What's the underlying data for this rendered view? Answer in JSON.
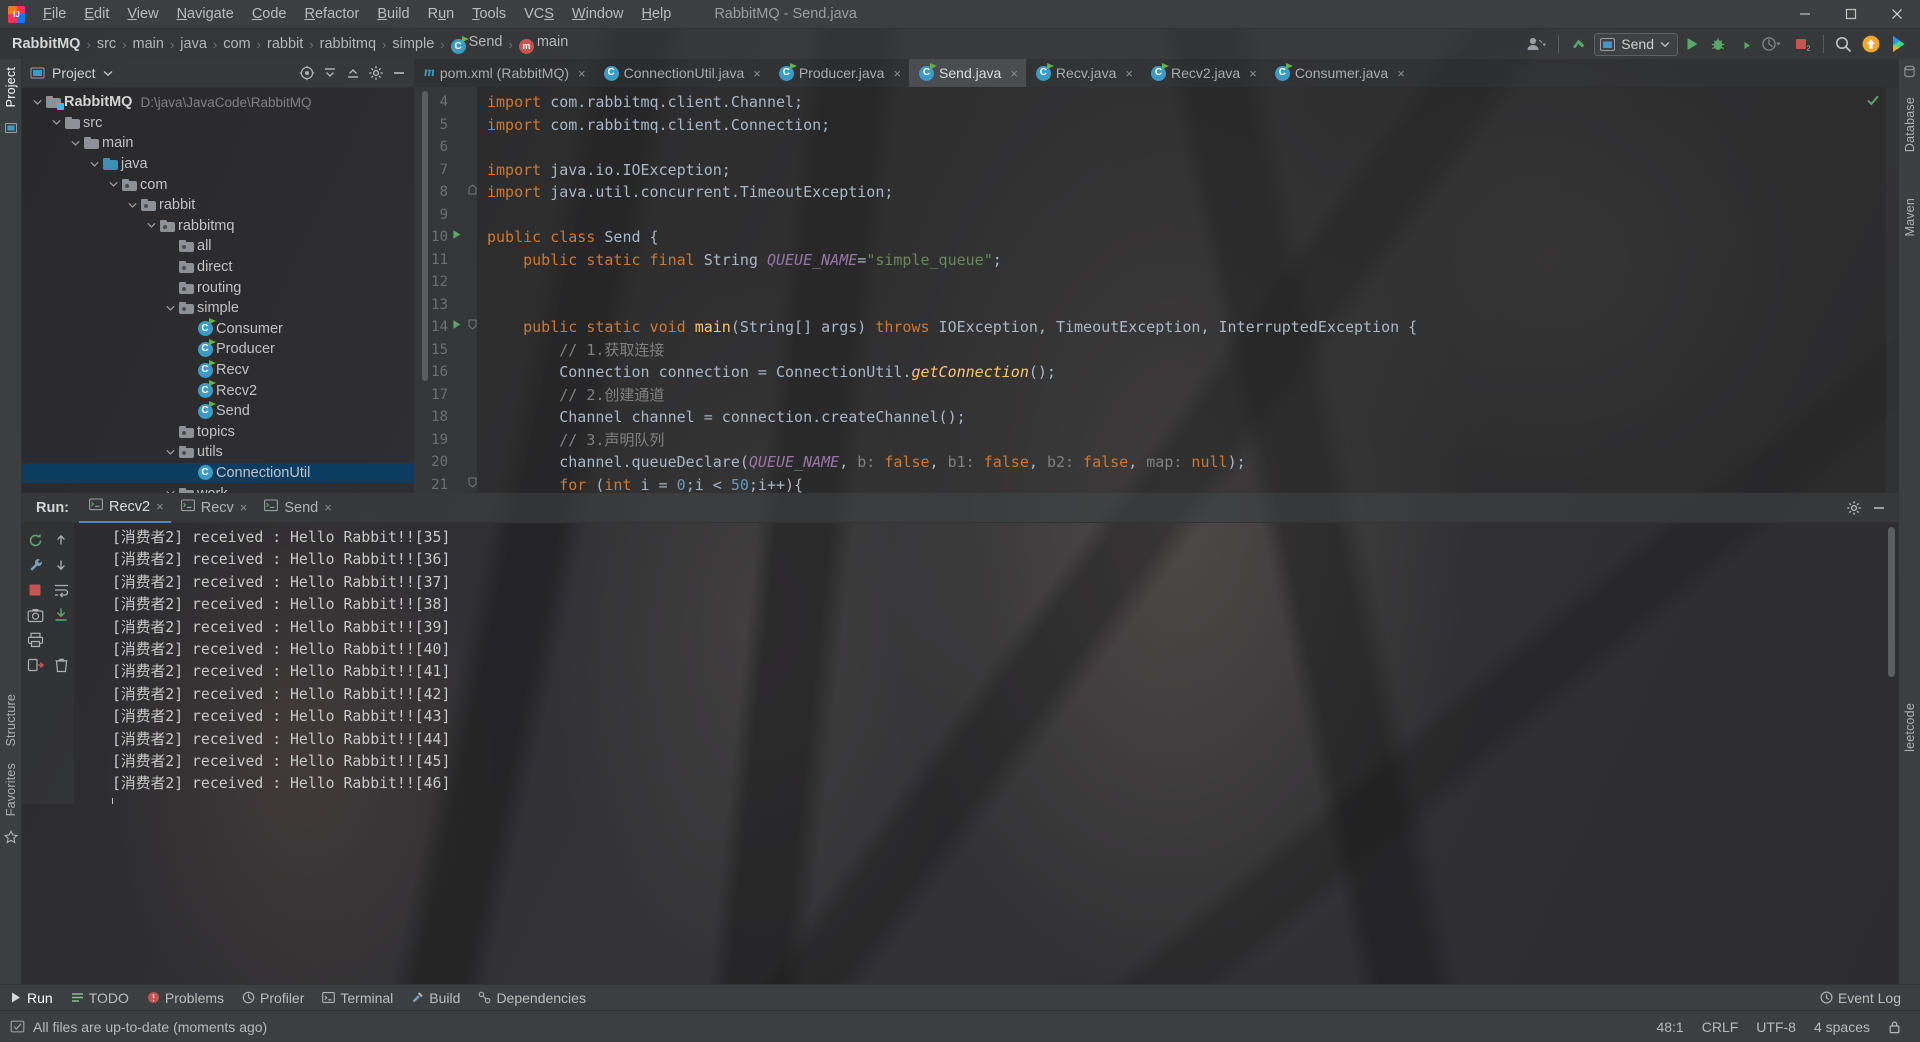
{
  "window": {
    "title": "RabbitMQ - Send.java",
    "menu": [
      "File",
      "Edit",
      "View",
      "Navigate",
      "Code",
      "Refactor",
      "Build",
      "Run",
      "Tools",
      "VCS",
      "Window",
      "Help"
    ],
    "controls": {
      "minimize": "minimize-icon",
      "maximize": "maximize-icon",
      "close": "close-icon"
    }
  },
  "navbar": {
    "breadcrumbs": [
      {
        "label": "RabbitMQ",
        "icon": ""
      },
      {
        "label": "src",
        "icon": ""
      },
      {
        "label": "main",
        "icon": ""
      },
      {
        "label": "java",
        "icon": ""
      },
      {
        "label": "com",
        "icon": ""
      },
      {
        "label": "rabbit",
        "icon": ""
      },
      {
        "label": "rabbitmq",
        "icon": ""
      },
      {
        "label": "simple",
        "icon": ""
      },
      {
        "label": "Send",
        "icon": "class-icon"
      },
      {
        "label": "main",
        "icon": "method-icon"
      }
    ],
    "separator": "›",
    "toolbar": {
      "account": "account-icon",
      "update": "vcs-update-icon",
      "run_config": "Send",
      "run_config_icon": "run-config-icon",
      "dropdown": "chevron-down-icon",
      "run": "run-icon",
      "debug": "debug-icon",
      "coverage": "run-coverage-icon",
      "profiler": "profiler-icon",
      "stop": "stop-icon",
      "stop_badge": "2",
      "search": "search-icon",
      "upload": "upload-icon",
      "idea_feature": "idea-icon"
    }
  },
  "left_strip": {
    "project_label": "Project",
    "structure_label": "Structure",
    "favorites_label": "Favorites",
    "bookmark_icon": "star-icon"
  },
  "right_strip": {
    "labels": [
      "Database",
      "Maven",
      "leetcode"
    ]
  },
  "project_panel": {
    "title": "Project",
    "title_icon": "project-icon",
    "title_dropdown": "chevron-down-icon",
    "actions": [
      "locate-icon",
      "collapse-all-icon",
      "expand-all-icon",
      "settings-icon",
      "hide-icon"
    ],
    "tree": [
      {
        "depth": 0,
        "label": "RabbitMQ",
        "sub": "D:\\java\\JavaCode\\RabbitMQ",
        "icon": "module-icon",
        "arrow": "expanded",
        "bold": true,
        "selected": false
      },
      {
        "depth": 1,
        "label": "src",
        "sub": "",
        "icon": "folder-icon",
        "arrow": "expanded",
        "bold": false,
        "selected": false
      },
      {
        "depth": 2,
        "label": "main",
        "sub": "",
        "icon": "folder-icon",
        "arrow": "expanded",
        "bold": false,
        "selected": false
      },
      {
        "depth": 3,
        "label": "java",
        "sub": "",
        "icon": "source-folder-icon",
        "arrow": "expanded",
        "bold": false,
        "selected": false
      },
      {
        "depth": 4,
        "label": "com",
        "sub": "",
        "icon": "package-icon",
        "arrow": "expanded",
        "bold": false,
        "selected": false
      },
      {
        "depth": 5,
        "label": "rabbit",
        "sub": "",
        "icon": "package-icon",
        "arrow": "expanded",
        "bold": false,
        "selected": false
      },
      {
        "depth": 6,
        "label": "rabbitmq",
        "sub": "",
        "icon": "package-icon",
        "arrow": "expanded",
        "bold": false,
        "selected": false
      },
      {
        "depth": 7,
        "label": "all",
        "sub": "",
        "icon": "package-icon",
        "arrow": "none",
        "bold": false,
        "selected": false
      },
      {
        "depth": 7,
        "label": "direct",
        "sub": "",
        "icon": "package-icon",
        "arrow": "none",
        "bold": false,
        "selected": false
      },
      {
        "depth": 7,
        "label": "routing",
        "sub": "",
        "icon": "package-icon",
        "arrow": "none",
        "bold": false,
        "selected": false
      },
      {
        "depth": 7,
        "label": "simple",
        "sub": "",
        "icon": "package-icon",
        "arrow": "expanded",
        "bold": false,
        "selected": false
      },
      {
        "depth": 8,
        "label": "Consumer",
        "sub": "",
        "icon": "runnable-class-icon",
        "arrow": "none",
        "bold": false,
        "selected": false
      },
      {
        "depth": 8,
        "label": "Producer",
        "sub": "",
        "icon": "runnable-class-icon",
        "arrow": "none",
        "bold": false,
        "selected": false
      },
      {
        "depth": 8,
        "label": "Recv",
        "sub": "",
        "icon": "runnable-class-icon",
        "arrow": "none",
        "bold": false,
        "selected": false
      },
      {
        "depth": 8,
        "label": "Recv2",
        "sub": "",
        "icon": "runnable-class-icon",
        "arrow": "none",
        "bold": false,
        "selected": false
      },
      {
        "depth": 8,
        "label": "Send",
        "sub": "",
        "icon": "runnable-class-icon",
        "arrow": "none",
        "bold": false,
        "selected": false
      },
      {
        "depth": 7,
        "label": "topics",
        "sub": "",
        "icon": "package-icon",
        "arrow": "none",
        "bold": false,
        "selected": false
      },
      {
        "depth": 7,
        "label": "utils",
        "sub": "",
        "icon": "package-icon",
        "arrow": "expanded",
        "bold": false,
        "selected": false
      },
      {
        "depth": 8,
        "label": "ConnectionUtil",
        "sub": "",
        "icon": "class-icon",
        "arrow": "none",
        "bold": false,
        "selected": true
      },
      {
        "depth": 7,
        "label": "work",
        "sub": "",
        "icon": "package-icon",
        "arrow": "expanded",
        "bold": false,
        "selected": false
      }
    ]
  },
  "editor": {
    "tabs": [
      {
        "label": "pom.xml (RabbitMQ)",
        "icon": "maven-icon",
        "active": false
      },
      {
        "label": "ConnectionUtil.java",
        "icon": "class-icon",
        "active": false
      },
      {
        "label": "Producer.java",
        "icon": "runnable-class-icon",
        "active": false
      },
      {
        "label": "Send.java",
        "icon": "runnable-class-icon",
        "active": true
      },
      {
        "label": "Recv.java",
        "icon": "runnable-class-icon",
        "active": false
      },
      {
        "label": "Recv2.java",
        "icon": "runnable-class-icon",
        "active": false
      },
      {
        "label": "Consumer.java",
        "icon": "runnable-class-icon",
        "active": false
      }
    ],
    "close_glyph": "×",
    "inspection_ok": "inspection-ok-icon",
    "first_line_number": 4,
    "lines": [
      {
        "n": 4,
        "gutter": "",
        "fold": "",
        "tokens": [
          {
            "t": "kw",
            "v": "import"
          },
          {
            "t": "txt",
            "v": " com.rabbitmq.client.Channel;"
          }
        ]
      },
      {
        "n": 5,
        "gutter": "",
        "fold": "",
        "tokens": [
          {
            "t": "kw",
            "v": "import"
          },
          {
            "t": "txt",
            "v": " com.rabbitmq.client.Connection;"
          }
        ]
      },
      {
        "n": 6,
        "gutter": "",
        "fold": "",
        "tokens": []
      },
      {
        "n": 7,
        "gutter": "",
        "fold": "",
        "tokens": [
          {
            "t": "kw",
            "v": "import"
          },
          {
            "t": "txt",
            "v": " java.io.IOException;"
          }
        ]
      },
      {
        "n": 8,
        "gutter": "",
        "fold": "collapse",
        "tokens": [
          {
            "t": "kw",
            "v": "import"
          },
          {
            "t": "txt",
            "v": " java.util.concurrent.TimeoutException;"
          }
        ]
      },
      {
        "n": 9,
        "gutter": "",
        "fold": "",
        "tokens": []
      },
      {
        "n": 10,
        "gutter": "run",
        "fold": "",
        "tokens": [
          {
            "t": "kw",
            "v": "public class"
          },
          {
            "t": "typ",
            "v": " Send {"
          }
        ]
      },
      {
        "n": 11,
        "gutter": "",
        "fold": "",
        "tokens": [
          {
            "t": "txt",
            "v": "    "
          },
          {
            "t": "kw",
            "v": "public static final"
          },
          {
            "t": "typ",
            "v": " String "
          },
          {
            "t": "fld",
            "v": "QUEUE_NAME"
          },
          {
            "t": "txt",
            "v": "="
          },
          {
            "t": "str",
            "v": "\"simple_queue\""
          },
          {
            "t": "txt",
            "v": ";"
          }
        ]
      },
      {
        "n": 12,
        "gutter": "",
        "fold": "",
        "tokens": []
      },
      {
        "n": 13,
        "gutter": "",
        "fold": "",
        "tokens": []
      },
      {
        "n": 14,
        "gutter": "run",
        "fold": "expand",
        "tokens": [
          {
            "t": "txt",
            "v": "    "
          },
          {
            "t": "kw",
            "v": "public static void"
          },
          {
            "t": "mth",
            "v": " main"
          },
          {
            "t": "txt",
            "v": "("
          },
          {
            "t": "typ",
            "v": "String[] args"
          },
          {
            "t": "txt",
            "v": ") "
          },
          {
            "t": "kw",
            "v": "throws"
          },
          {
            "t": "typ",
            "v": " IOException, TimeoutException, InterruptedException "
          },
          {
            "t": "txt",
            "v": "{"
          }
        ]
      },
      {
        "n": 15,
        "gutter": "",
        "fold": "",
        "tokens": [
          {
            "t": "cmt",
            "v": "        // 1.获取连接"
          }
        ]
      },
      {
        "n": 16,
        "gutter": "",
        "fold": "",
        "tokens": [
          {
            "t": "typ",
            "v": "        Connection connection = ConnectionUtil."
          },
          {
            "t": "mth-i",
            "v": "getConnection"
          },
          {
            "t": "typ",
            "v": "();"
          }
        ]
      },
      {
        "n": 17,
        "gutter": "",
        "fold": "",
        "tokens": [
          {
            "t": "cmt",
            "v": "        // 2.创建通道"
          }
        ]
      },
      {
        "n": 18,
        "gutter": "",
        "fold": "",
        "tokens": [
          {
            "t": "typ",
            "v": "        Channel channel = connection."
          },
          {
            "t": "mth-p",
            "v": "createChannel"
          },
          {
            "t": "typ",
            "v": "();"
          }
        ]
      },
      {
        "n": 19,
        "gutter": "",
        "fold": "",
        "tokens": [
          {
            "t": "cmt",
            "v": "        // 3.声明队列"
          }
        ]
      },
      {
        "n": 20,
        "gutter": "",
        "fold": "",
        "tokens": [
          {
            "t": "typ",
            "v": "        channel."
          },
          {
            "t": "mth-p",
            "v": "queueDeclare"
          },
          {
            "t": "typ",
            "v": "("
          },
          {
            "t": "fld",
            "v": "QUEUE_NAME"
          },
          {
            "t": "typ",
            "v": ", "
          },
          {
            "t": "hint",
            "v": "b:"
          },
          {
            "t": "kw",
            "v": " false"
          },
          {
            "t": "typ",
            "v": ", "
          },
          {
            "t": "hint",
            "v": "b1:"
          },
          {
            "t": "kw",
            "v": " false"
          },
          {
            "t": "typ",
            "v": ", "
          },
          {
            "t": "hint",
            "v": "b2:"
          },
          {
            "t": "kw",
            "v": " false"
          },
          {
            "t": "typ",
            "v": ", "
          },
          {
            "t": "hint",
            "v": "map:"
          },
          {
            "t": "kw",
            "v": " null"
          },
          {
            "t": "typ",
            "v": ");"
          }
        ]
      },
      {
        "n": 21,
        "gutter": "",
        "fold": "expand",
        "tokens": [
          {
            "t": "txt",
            "v": "        "
          },
          {
            "t": "kw",
            "v": "for"
          },
          {
            "t": "typ",
            "v": " ("
          },
          {
            "t": "kw",
            "v": "int"
          },
          {
            "t": "typ",
            "v": " i = "
          },
          {
            "t": "num",
            "v": "0"
          },
          {
            "t": "typ",
            "v": ";i < "
          },
          {
            "t": "num",
            "v": "50"
          },
          {
            "t": "typ",
            "v": ";i++){"
          }
        ]
      }
    ]
  },
  "run_panel": {
    "label": "Run:",
    "tabs": [
      {
        "label": "Recv2",
        "icon": "console-icon",
        "active": true
      },
      {
        "label": "Recv",
        "icon": "console-icon",
        "active": false
      },
      {
        "label": "Send",
        "icon": "console-icon",
        "active": false
      }
    ],
    "close_glyph": "×",
    "head_actions": [
      "settings-icon",
      "hide-icon"
    ],
    "sidebar_actions": [
      "rerun-icon",
      "up-icon",
      "wrench-icon",
      "down-icon",
      "stop-icon",
      "soft-wrap-icon",
      "camera-icon",
      "scroll-to-end-icon",
      "print-icon",
      "clear-all-icon",
      "trash-icon"
    ],
    "console_lines": [
      "[消费者2] received : Hello Rabbit!![35]",
      "[消费者2] received : Hello Rabbit!![36]",
      "[消费者2] received : Hello Rabbit!![37]",
      "[消费者2] received : Hello Rabbit!![38]",
      "[消费者2] received : Hello Rabbit!![39]",
      "[消费者2] received : Hello Rabbit!![40]",
      "[消费者2] received : Hello Rabbit!![41]",
      "[消费者2] received : Hello Rabbit!![42]",
      "[消费者2] received : Hello Rabbit!![43]",
      "[消费者2] received : Hello Rabbit!![44]",
      "[消费者2] received : Hello Rabbit!![45]",
      "[消费者2] received : Hello Rabbit!![46]"
    ]
  },
  "tool_window_bar": {
    "items": [
      {
        "label": "Run",
        "icon": "run-icon",
        "active": true
      },
      {
        "label": "TODO",
        "icon": "todo-icon",
        "active": false
      },
      {
        "label": "Problems",
        "icon": "problems-icon",
        "active": false
      },
      {
        "label": "Profiler",
        "icon": "profiler-icon",
        "active": false
      },
      {
        "label": "Terminal",
        "icon": "terminal-icon",
        "active": false
      },
      {
        "label": "Build",
        "icon": "build-icon",
        "active": false
      },
      {
        "label": "Dependencies",
        "icon": "dependencies-icon",
        "active": false
      }
    ],
    "event_log": {
      "label": "Event Log",
      "icon": "event-log-icon"
    }
  },
  "statusbar": {
    "message": "All files are up-to-date (moments ago)",
    "message_icon": "sync-ok-icon",
    "caret_position": "48:1",
    "line_separator": "CRLF",
    "encoding": "UTF-8",
    "indent": "4 spaces"
  },
  "colors": {
    "accent_blue": "#4a88c7",
    "selection_blue": "#0d3c61",
    "keyword_orange": "#cc7832",
    "string_green": "#6a8759",
    "comment_gray": "#808080",
    "field_purple": "#9876aa",
    "method_yellow": "#ffc66d",
    "text_default": "#a9b7c6",
    "number_blue": "#6897bb",
    "run_green": "#62b543",
    "stop_red": "#c75450",
    "panel_bg": "#3c3f41"
  }
}
